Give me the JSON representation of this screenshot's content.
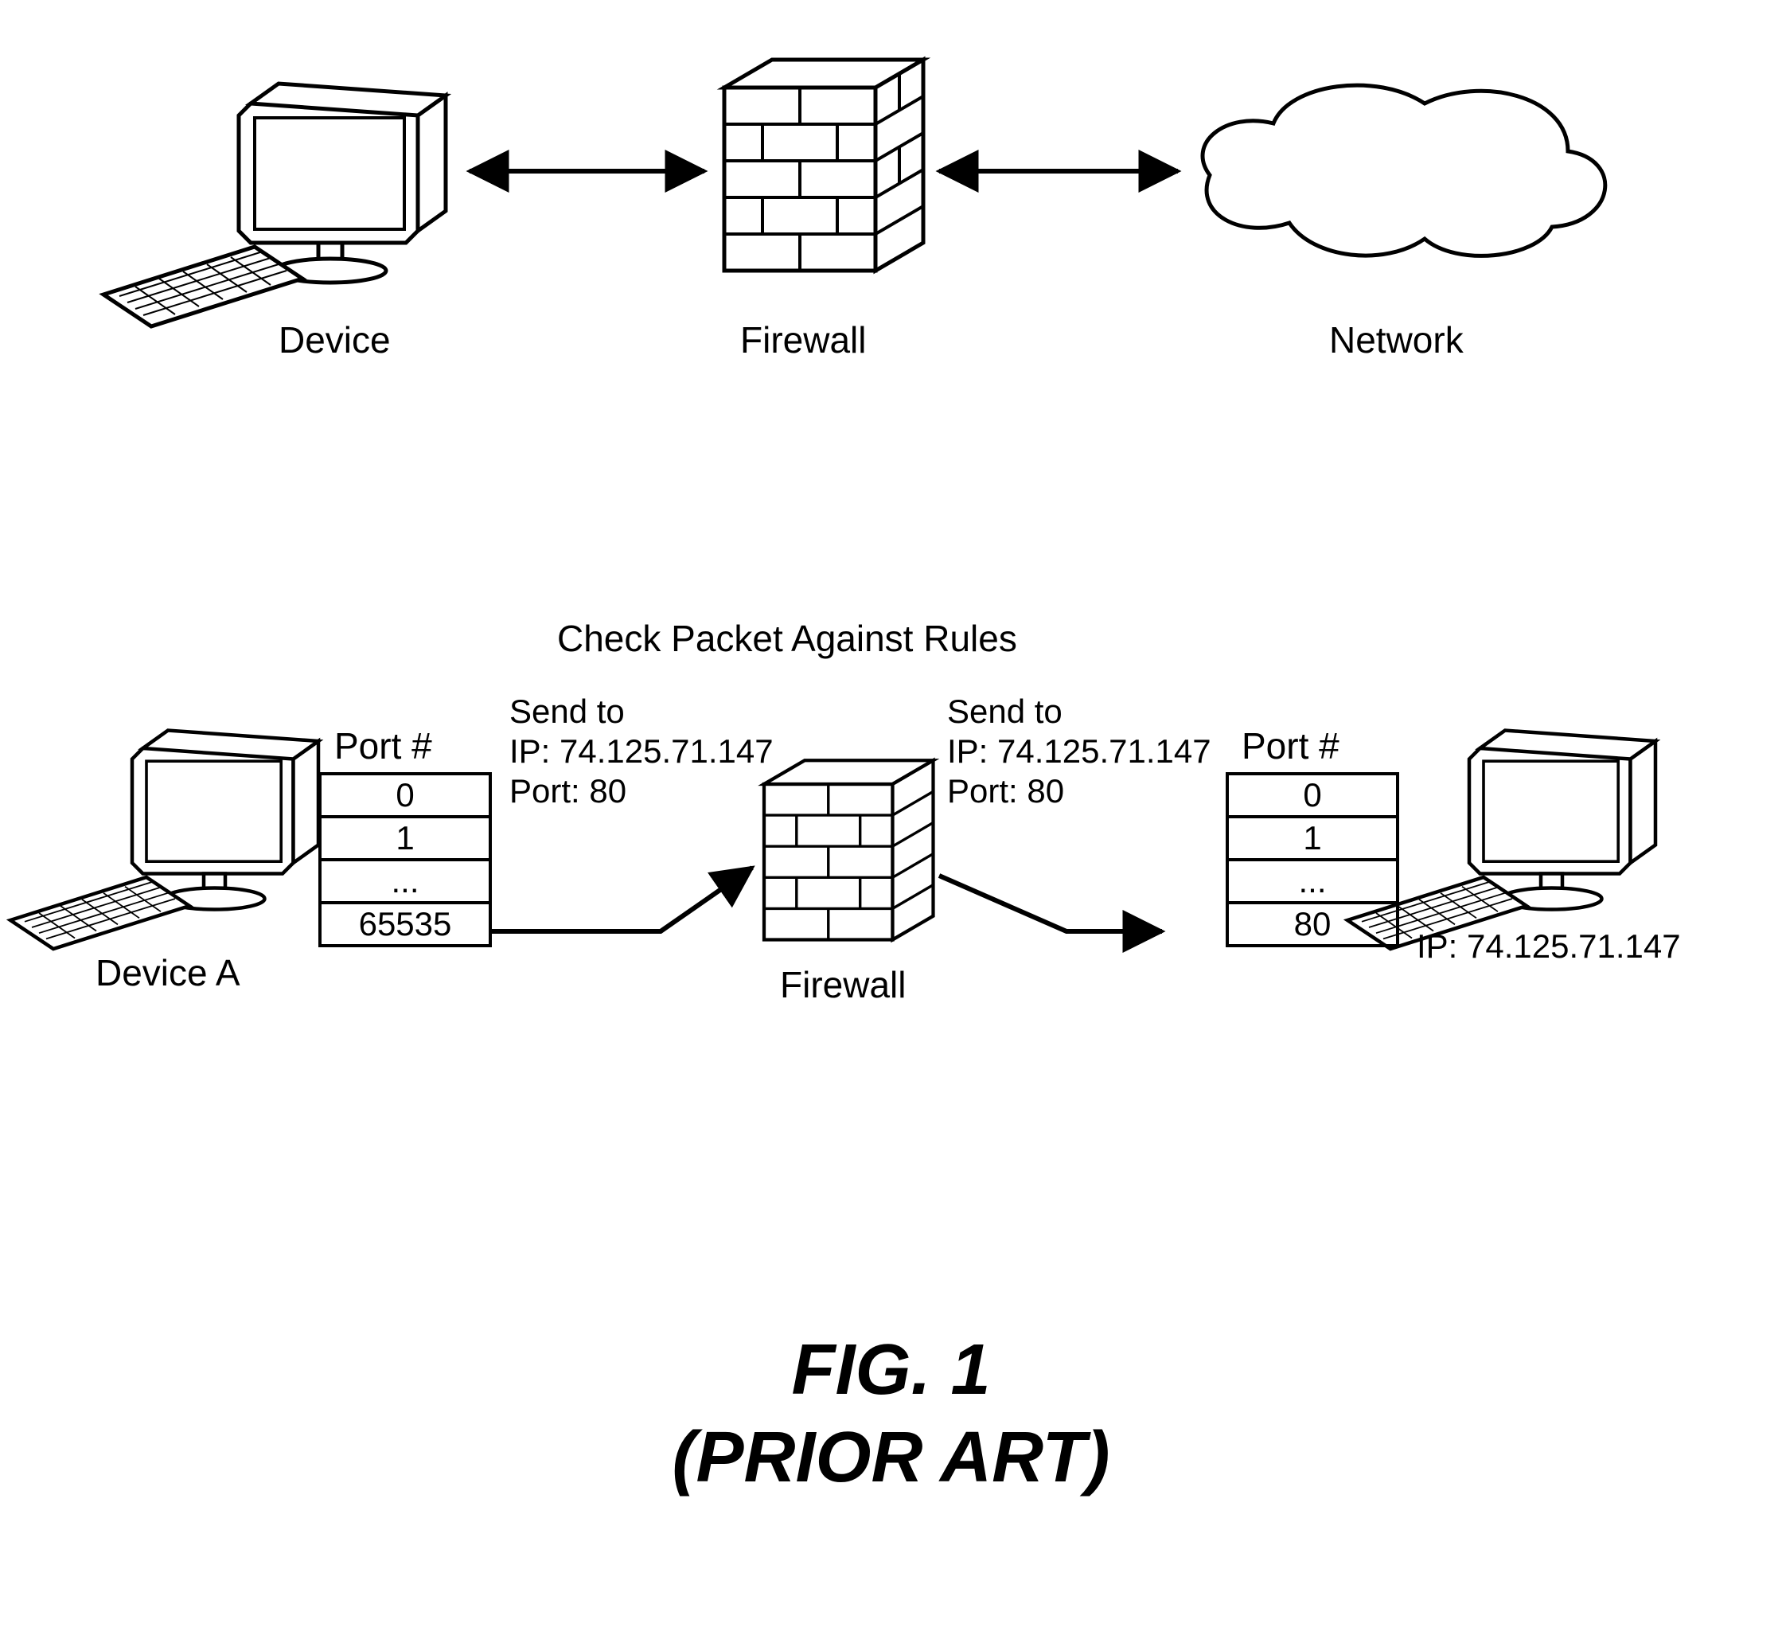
{
  "topRow": {
    "deviceLabel": "Device",
    "firewallLabel": "Firewall",
    "networkLabel": "Network"
  },
  "midTitle": "Check Packet Against Rules",
  "left": {
    "portHeader": "Port #",
    "ports": {
      "p0": "0",
      "p1": "1",
      "p2": "...",
      "p3": "65535"
    },
    "deviceLabel": "Device A",
    "packet": {
      "line1": "Send to",
      "line2": "IP: 74.125.71.147",
      "line3": "Port: 80"
    }
  },
  "right": {
    "portHeader": "Port #",
    "ports": {
      "p0": "0",
      "p1": "1",
      "p2": "...",
      "p3": "80"
    },
    "ip": "IP: 74.125.71.147",
    "packet": {
      "line1": "Send to",
      "line2": "IP: 74.125.71.147",
      "line3": "Port: 80"
    }
  },
  "firewallLabel2": "Firewall",
  "caption": {
    "line1": "FIG. 1",
    "line2": "(PRIOR ART)"
  }
}
